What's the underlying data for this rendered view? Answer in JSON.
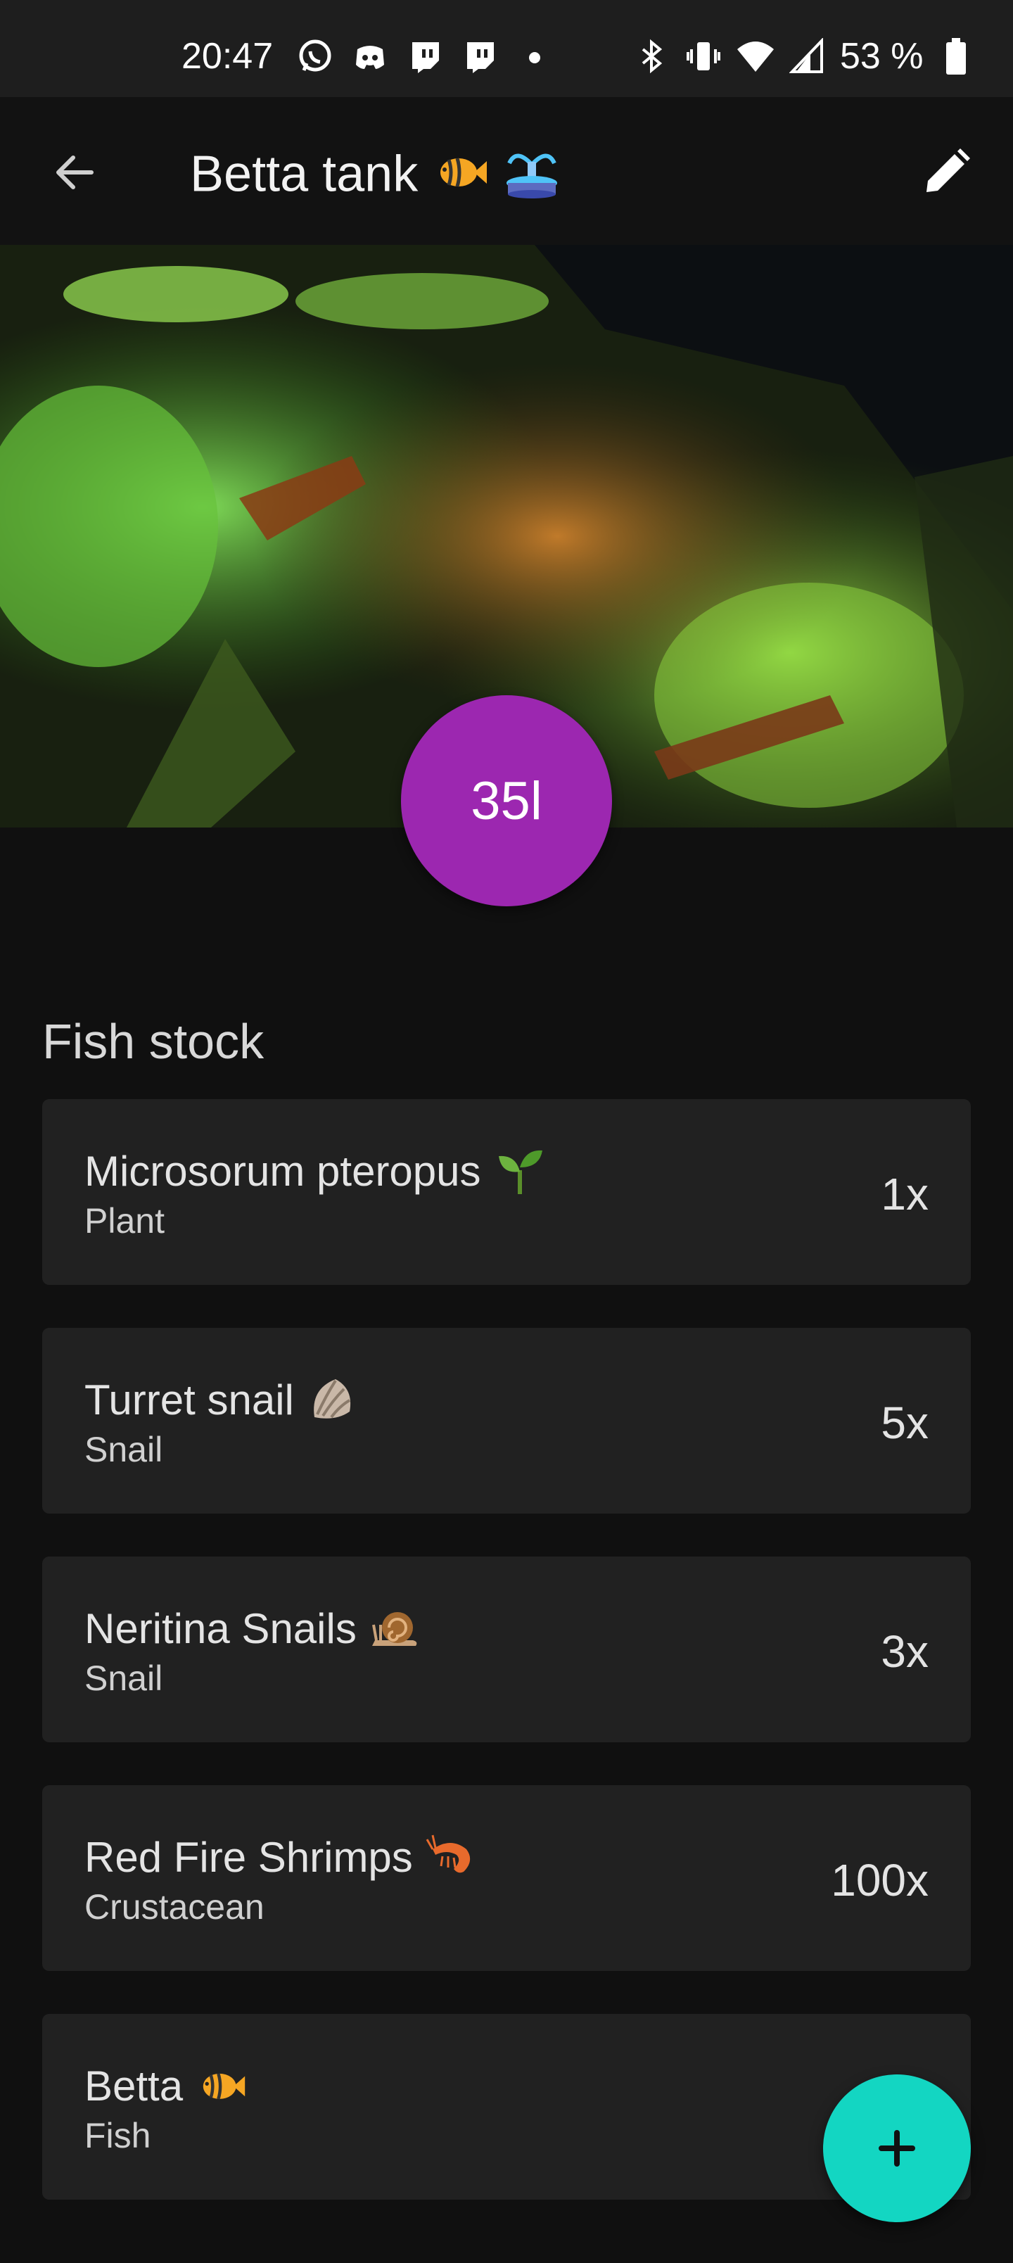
{
  "status_bar": {
    "time": "20:47",
    "icons_left": [
      "whatsapp-icon",
      "discord-icon",
      "twitch-icon",
      "twitch-icon",
      "dot-icon"
    ],
    "icons_right": [
      "bluetooth-icon",
      "vibrate-icon",
      "wifi-icon",
      "signal-icon",
      "battery-icon"
    ],
    "battery_text": "53 %"
  },
  "app_bar": {
    "title": "Betta tank",
    "title_emojis": [
      "fish-emoji",
      "fountain-emoji"
    ],
    "back_icon": "arrow-back-icon",
    "edit_icon": "pencil-icon"
  },
  "hero": {
    "image": "aquarium-photo",
    "volume": "35l",
    "volume_color": "#9c27b0"
  },
  "stock": {
    "title": "Fish stock",
    "items": [
      {
        "name": "Microsorum pteropus",
        "emoji": "seedling-emoji",
        "type": "Plant",
        "count": "1x"
      },
      {
        "name": "Turret snail",
        "emoji": "shell-emoji",
        "type": "Snail",
        "count": "5x"
      },
      {
        "name": "Neritina Snails",
        "emoji": "snail-emoji",
        "type": "Snail",
        "count": "3x"
      },
      {
        "name": "Red Fire Shrimps",
        "emoji": "shrimp-emoji",
        "type": "Crustacean",
        "count": "100x"
      },
      {
        "name": "Betta",
        "emoji": "fish-emoji",
        "type": "Fish",
        "count": ""
      }
    ]
  },
  "fab": {
    "icon": "plus-icon",
    "color": "#13d6c2"
  }
}
